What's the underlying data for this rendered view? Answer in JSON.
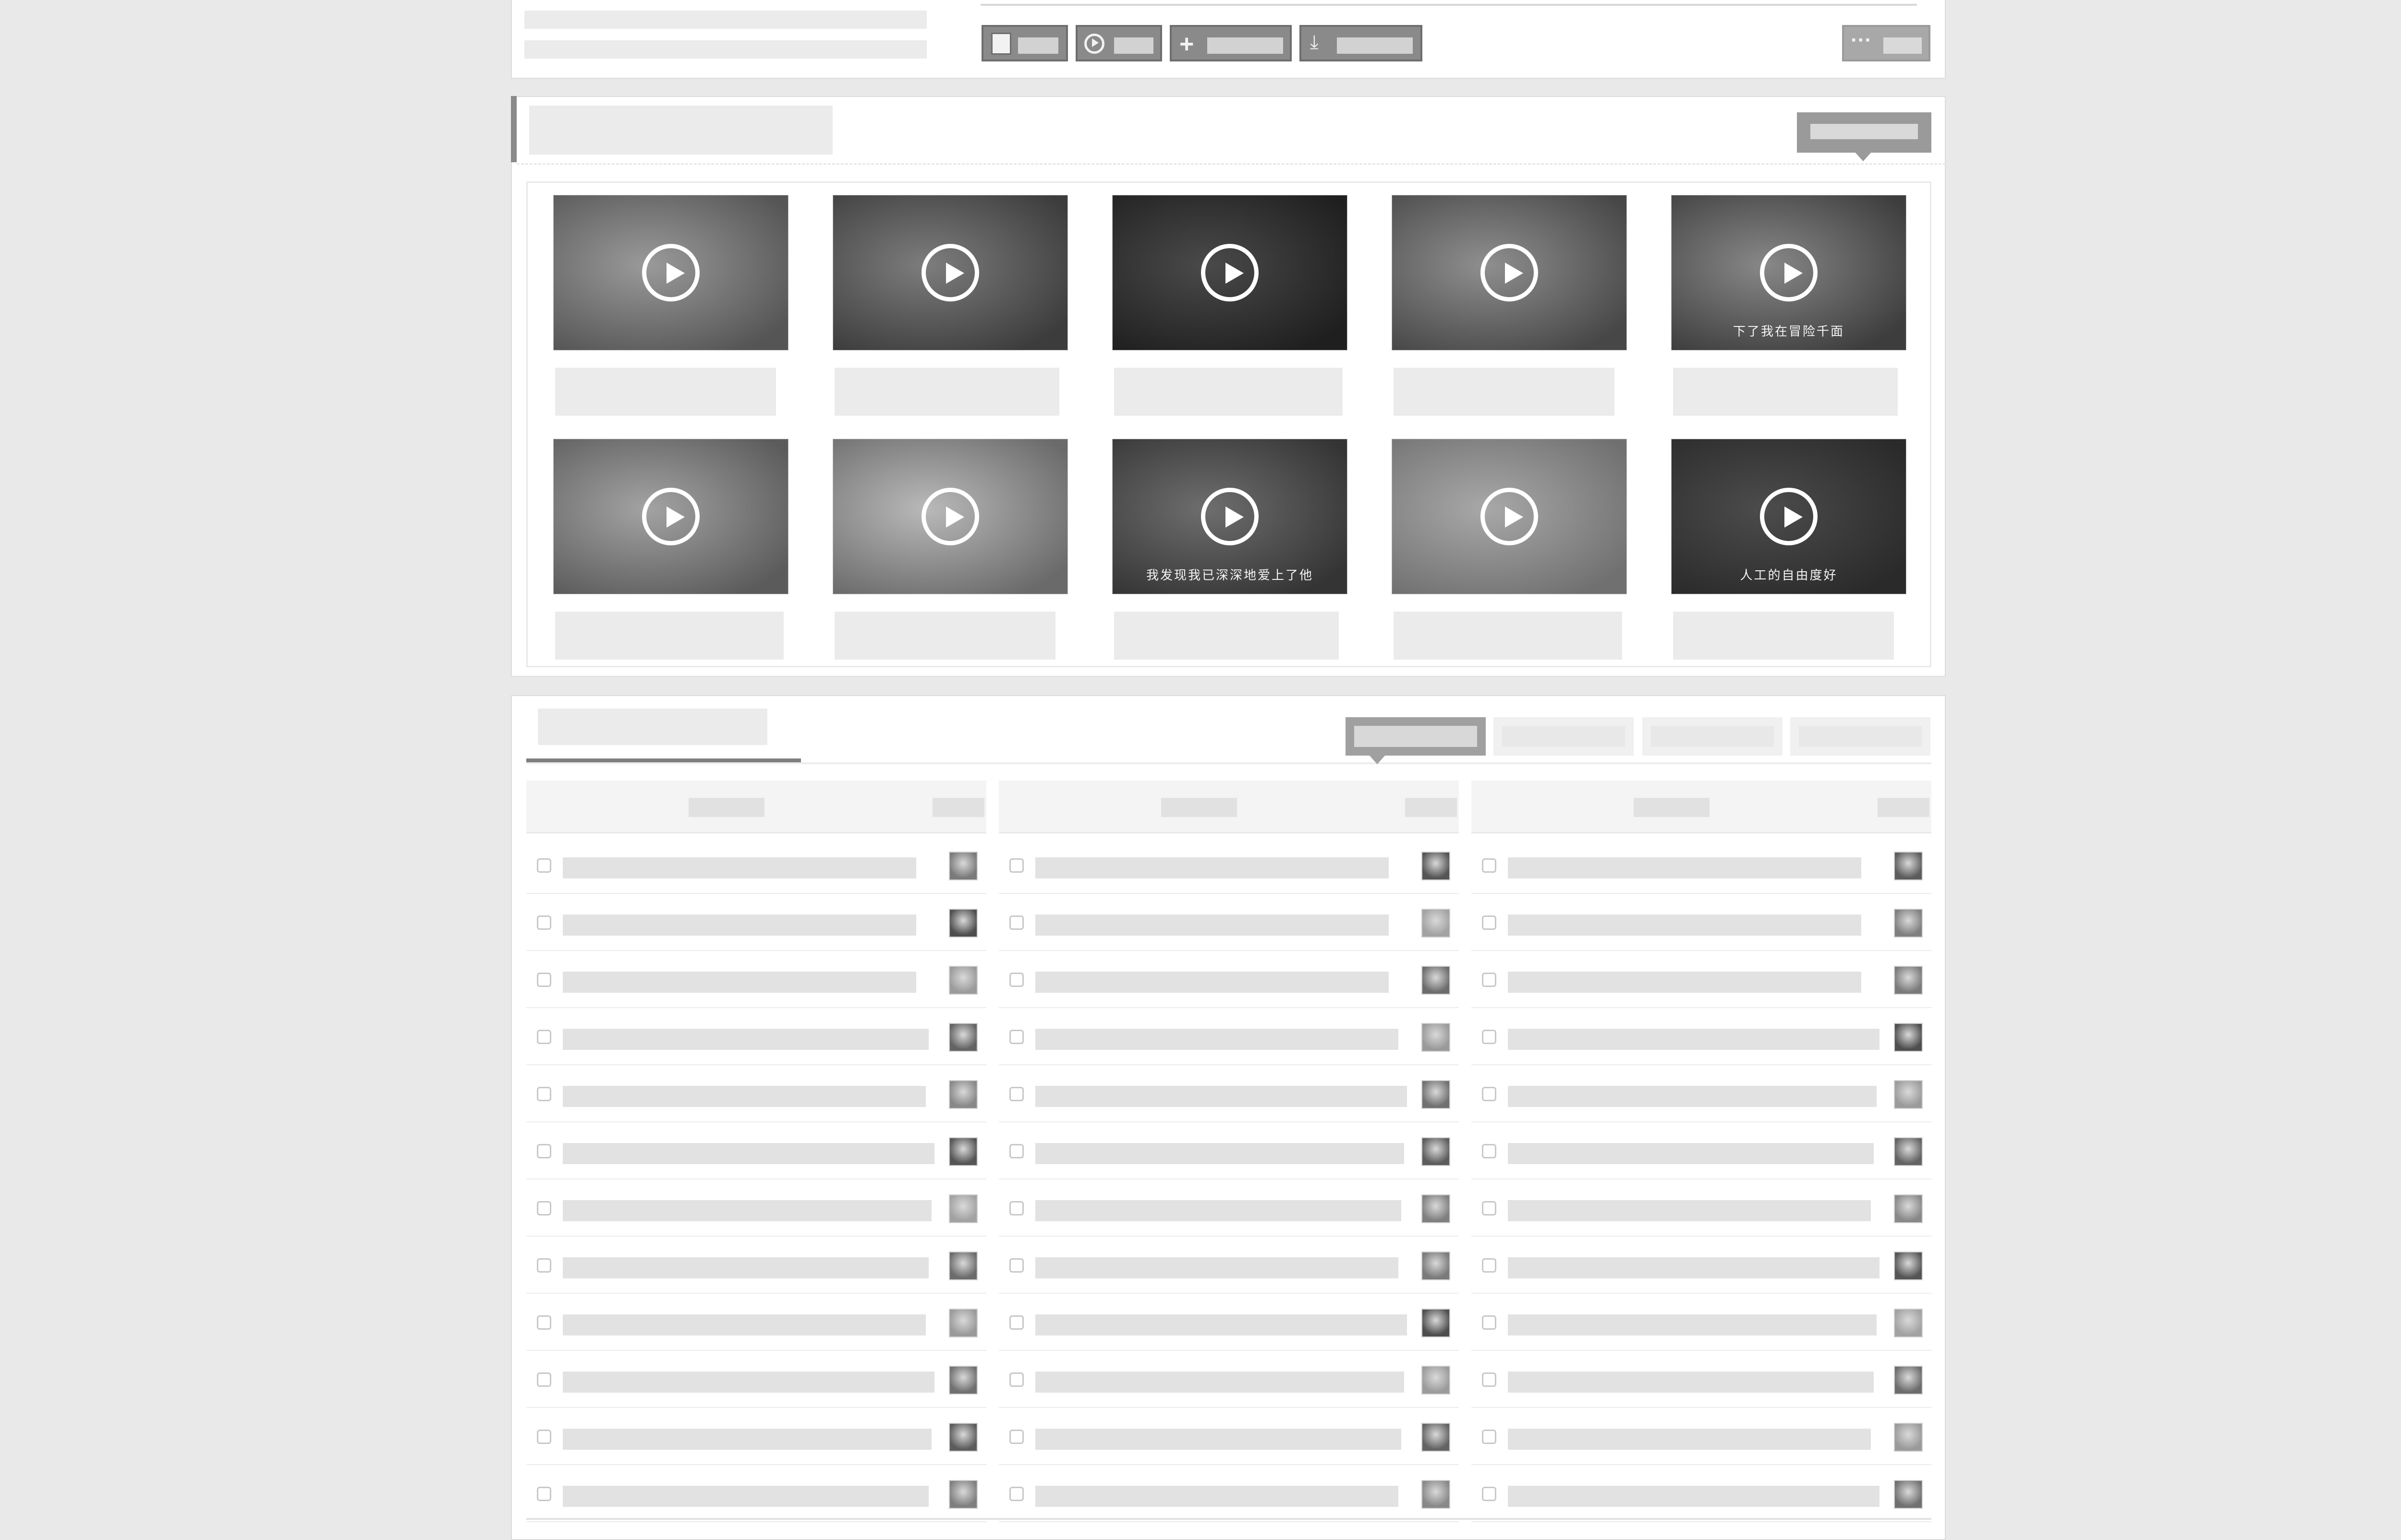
{
  "toolbar": {
    "buttons": [
      {
        "icon": "stop-square-icon"
      },
      {
        "icon": "play-circle-icon"
      },
      {
        "icon": "plus-icon"
      },
      {
        "icon": "download-icon"
      },
      {
        "icon": "more-dots-icon"
      }
    ]
  },
  "video_section": {
    "videos": [
      {
        "caption": ""
      },
      {
        "caption": ""
      },
      {
        "caption": ""
      },
      {
        "caption": ""
      },
      {
        "caption": "下了我在冒险千面"
      },
      {
        "caption": ""
      },
      {
        "caption": ""
      },
      {
        "caption": "我发现我已深深地爱上了他"
      },
      {
        "caption": ""
      },
      {
        "caption": "人工的自由度好"
      }
    ]
  },
  "songs_section": {
    "tabs": [
      {
        "active": true
      },
      {
        "active": false
      },
      {
        "active": false
      },
      {
        "active": false
      }
    ],
    "columns": [
      {
        "rows": 12
      },
      {
        "rows": 12
      },
      {
        "rows": 12
      }
    ]
  },
  "colors": {
    "page_bg": "#e9e9e9",
    "panel_bg": "#ffffff",
    "button_bg": "#8a8a8a",
    "accent_gray": "#777777"
  }
}
